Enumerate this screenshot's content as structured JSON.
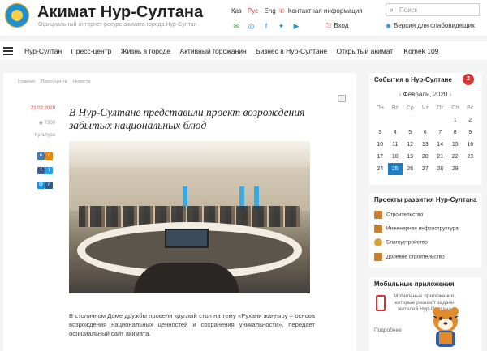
{
  "header": {
    "title": "Акимат Нур-Султана",
    "subtitle": "Официальный интернет-ресурс акимата города Нур-Султан",
    "languages": [
      {
        "label": "Қаз",
        "active": false
      },
      {
        "label": "Рус",
        "active": true
      },
      {
        "label": "Eng",
        "active": false
      }
    ],
    "contact_label": "Контактная информация",
    "search_placeholder": "Поиск",
    "login_label": "Вход",
    "visually_impaired_label": "Версия для слабовидящих",
    "social_icons": [
      "mail-icon",
      "instagram-icon",
      "facebook-icon",
      "twitter-icon",
      "youtube-icon"
    ]
  },
  "nav": {
    "items": [
      "Нур-Султан",
      "Пресс-центр",
      "Жизнь в городе",
      "Активный горожанин",
      "Бизнес в Нур-Султане",
      "Открытый акимат",
      "iKomek 109"
    ]
  },
  "article": {
    "breadcrumb": [
      "Главная",
      "Пресс-центр",
      "Новости"
    ],
    "date": "21.02.2020",
    "views": "7300",
    "category": "Культура",
    "share_icons": [
      "vk-icon",
      "ok-icon",
      "facebook-icon",
      "twitter-icon",
      "mailru-icon",
      "livejournal-icon"
    ],
    "title": "В Нур-Султане представили проект возрождения забытых национальных блюд",
    "paragraph": "В столичном Доме дружбы провели круглый стол на тему «Рухани жаңғыру – основа возрождения национальных ценностей и сохранения уникальности», передает официальный сайт акимата."
  },
  "events": {
    "title": "События в Нур-Султане",
    "badge": "2",
    "month": "Февраль, 2020",
    "weekdays": [
      "Пн",
      "Вт",
      "Ср",
      "Чт",
      "Пт",
      "Сб",
      "Вс"
    ],
    "weeks": [
      [
        "",
        "",
        "",
        "",
        "",
        "1",
        "2"
      ],
      [
        "3",
        "4",
        "5",
        "6",
        "7",
        "8",
        "9"
      ],
      [
        "10",
        "11",
        "12",
        "13",
        "14",
        "15",
        "16"
      ],
      [
        "17",
        "18",
        "19",
        "20",
        "21",
        "22",
        "23"
      ],
      [
        "24",
        "25",
        "26",
        "27",
        "28",
        "29",
        ""
      ]
    ],
    "today": "25"
  },
  "projects": {
    "title": "Проекты развития Нур-Султана",
    "items": [
      {
        "label": "Строительство",
        "icon": "brick-icon",
        "color": "#c9802c"
      },
      {
        "label": "Инженерная инфраструктура",
        "icon": "brick-icon",
        "color": "#c9802c"
      },
      {
        "label": "Благоустройство",
        "icon": "tree-icon",
        "color": "#d9a13a"
      },
      {
        "label": "Долевое строительство",
        "icon": "brick-icon",
        "color": "#c9802c"
      }
    ]
  },
  "mobile": {
    "title": "Мобильные приложения",
    "text": "Мобильные приложения, которые решают задачи жителей Нур-Султана",
    "more_label": "Подробнее"
  },
  "colors": {
    "accent_red": "#d93434",
    "accent_blue": "#1f7ec1"
  }
}
